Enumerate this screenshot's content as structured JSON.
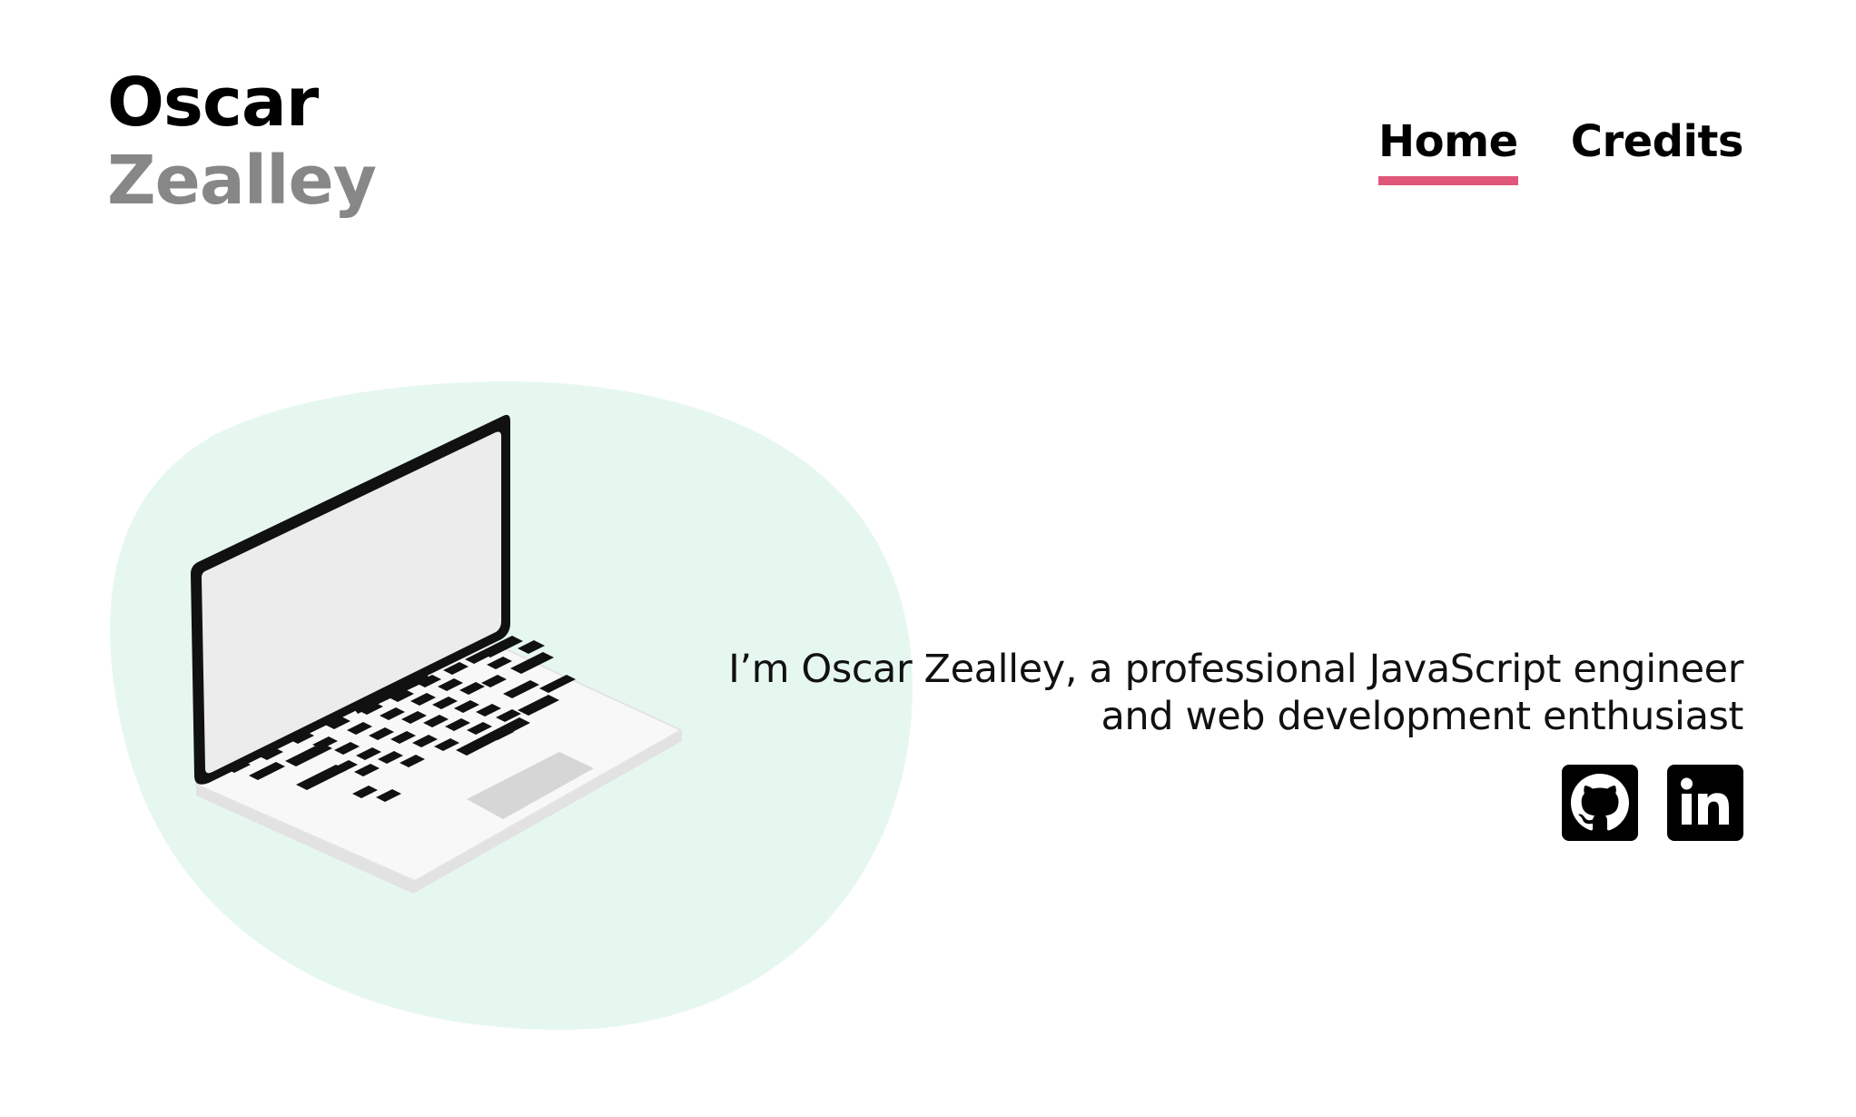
{
  "header": {
    "first_name": "Oscar",
    "last_name": "Zealley"
  },
  "nav": {
    "items": [
      {
        "label": "Home",
        "active": true
      },
      {
        "label": "Credits",
        "active": false
      }
    ]
  },
  "hero": {
    "tagline_line1": "I’m Oscar Zealley, a professional JavaScript engineer",
    "tagline_line2": "and web development enthusiast",
    "illustration": "laptop-illustration",
    "blob_color": "#e6f7ef"
  },
  "social": {
    "links": [
      {
        "icon": "github-icon"
      },
      {
        "icon": "linkedin-icon"
      }
    ]
  },
  "colors": {
    "accent": "#e0577a",
    "name_secondary": "#878787",
    "text": "#000000"
  }
}
